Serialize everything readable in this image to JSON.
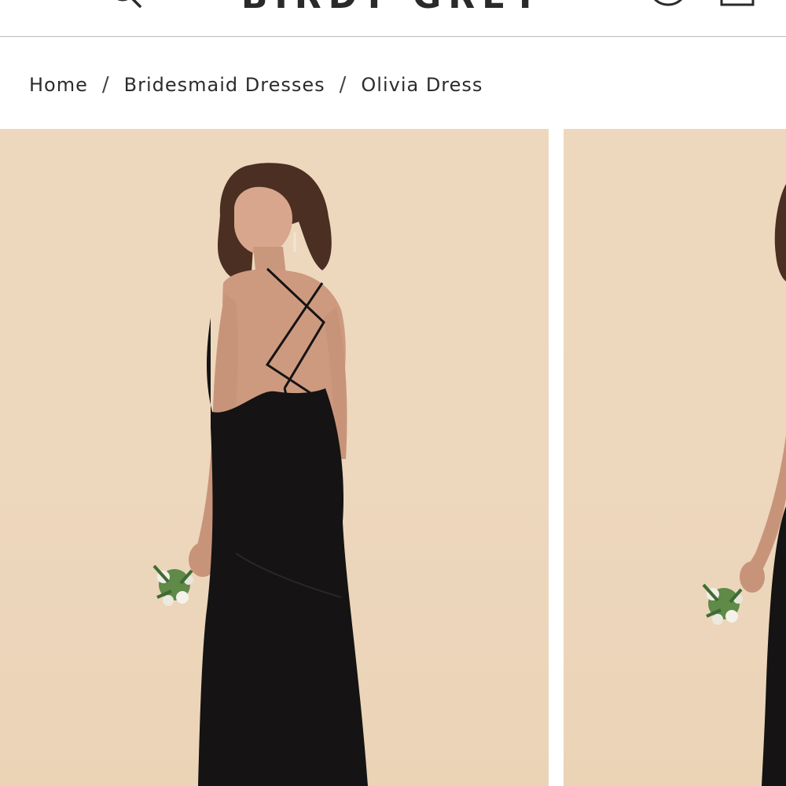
{
  "header": {
    "brand": "BIRDY GREY",
    "icons": [
      "menu-icon",
      "search-icon",
      "account-icon",
      "bag-icon"
    ]
  },
  "breadcrumb": [
    {
      "label": "Home"
    },
    {
      "label": "Bridesmaid Dresses"
    },
    {
      "label": "Olivia Dress"
    }
  ],
  "breadcrumb_separator": "/",
  "gallery": {
    "images": [
      {
        "subject": "model in black Olivia satin slip dress, back view, holding small white and green bouquet"
      },
      {
        "subject": "model in black Olivia satin slip dress, side view, holding small white and green bouquet"
      }
    ]
  },
  "colors": {
    "backdrop": "#EDD7BD",
    "dress": "#141212",
    "text": "#2B2B2B",
    "divider": "#BDBDBD"
  }
}
